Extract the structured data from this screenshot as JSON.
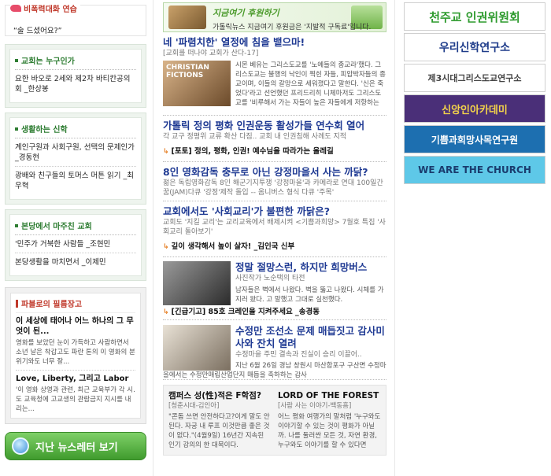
{
  "left": {
    "dialog": {
      "title": "비폭력대화 연습",
      "text": "“술 드셨어요?”"
    },
    "church": {
      "title": "교회는 누구인가",
      "items": [
        "요한 바오로 2세와 제2차 바티칸공의회 _한상봉"
      ]
    },
    "faith": {
      "title": "생활하는 신학",
      "items": [
        "계인구원과 사회구원, 선택의 문제인가 _경동현",
        "광배와 친구들의 토머스 머튼 읽기 _최우혁"
      ]
    },
    "meet": {
      "title": "본당에서 마주친 교회",
      "items": [
        "'민주가 거북한 사람들 _조현민",
        "본당생활을 마치면서 _이제민"
      ]
    },
    "ad": {
      "title": "파블로의 필름장고",
      "item1_title": "이 세상에 태어나 어느 하나의 그 무엇이 된...",
      "item1_desc": "영화를 보았던 눈이 가득하고 사람하면서 소년 날은 착갑고도 파란 톤의 이 영화의 분위기와도 너무 잘...",
      "item2_title": "Love, Liberty, 그리고 Labor",
      "item2_desc": "'이 영화 상영과 관련, 최근 교육부가 각 시.도 교육청에 고교생의 관람금지 지시를 내리는..."
    },
    "newsletter_button": "지난 뉴스레터 보기"
  },
  "center": {
    "banner": {
      "t1": "지금여기 후원하기",
      "t2": "가톨릭뉴스 지금여기 후원금은 '지발적 구독료'입니다."
    },
    "article1": {
      "title": "네 '파렴치한' 열정에 침을 뱉으마!",
      "sub": "[교회를 떠나야 교회가 산다-17]",
      "body": "시몬 베유는 그리스도교를 '노예들의 종교라'했다. 그리스도교는 불행의 낙인이 찍힌 자들, 피압박자들의 종교이며, 이들의 갈망으로 세워졌다고 말한다. '신은 죽었다'라고 선언했던 프리드리히 니체마저도 그리스도교를 '비루해서 가는 자들이 높은 자들에게 저항하는"
    },
    "article2": {
      "title": "가톨릭 정의 평화 인권운동 활성가들 연수회 열어",
      "sub": "각 교구 정평위 교류 확산 다짐.. 교회 내 인권침해 사례도 지적",
      "related": "[포토] 정의, 평화, 인권! 예수님을 따라가는 올레길"
    },
    "article3": {
      "title": "8인 영화감독 충무로 아닌 강정마을서 사는 까닭?",
      "sub": "젊은 독립영화감독 8인 해군기지투쟁 '강정마을'과 카메라로 연대 100일간 꿈(JAM)다큐 '강정'제작 돌입 -- 옴니버스 형식 다큐 '주목'"
    },
    "article4": {
      "title": "교회에서도 '사회교리'가 불편한 까닭은?",
      "sub": "교회도 '지킬 교리'는 교리교육에서 배제시켜 <기쁨과희망> 7월호 특집 '사회교리 돌아보기'",
      "related": "깊이 생각해서 높이 살자! _김인국 신부"
    },
    "article5": {
      "title": "정말 절망스런, 하지만 희망버스",
      "sub": "사진작가 노순택의 타전",
      "body": "남자들은 벽에서 나왔다. 벽을 뚫고 나왔다. 시체를 가지러 왔다. 고 말했고 그대로 실천했다.",
      "related": "[긴급기고] 85호 크레인을 지켜주세요 _송경동"
    },
    "article6": {
      "title": "수정만 조선소 문제 매듭짓고 감사미사와 잔치 열려",
      "sub": "수정마을 주민 결속과 진실이 승리 이끌어..",
      "body": "지난 6월 26일 경남 창원시 마산합포구 구산면 수정마을에서는 수정만매립산업단지 매듭을 축하하는 감사"
    },
    "bottom": {
      "left_title": "캠퍼스 성(性)적은 F학점?",
      "left_sub": "[청춘시대-김인아]",
      "left_body": "\"콘돔 쓰면 안전하다고?이게 말도 안된다. 자궁 내 루프 이것만큼 좋은 것이 없다.\"(4월9일) 16년간 지속된 인기 강의의 한 대목이다.",
      "right_title": "LORD OF THE FOREST",
      "right_sub": "[사람 사는 이야기-백동흠]",
      "right_body": "어느 평화 여행가의 말처럼 '누구와도 이야기할 수 있는 것이 평화가 아닐까. 나를 둘러싼 모든 것, 자연 환경, 누구와도 이야기를 할 수 있다면"
    }
  },
  "right": {
    "banners": [
      {
        "label": "천주교 인권위원회",
        "color": "#2e9b2e",
        "bg": "#ffffff"
      },
      {
        "label": "우리신학연구소",
        "color": "#1f3c8a",
        "bg": "#ffffff"
      },
      {
        "label": "제3시대그리스도교연구소",
        "color": "#444444",
        "bg": "#ffffff"
      },
      {
        "label": "신앙인아카데미",
        "color": "#f3d34a",
        "bg": "#4a2f78"
      },
      {
        "label": "기쁨과희망사목연구원",
        "color": "#ffffff",
        "bg": "#1d6fb0"
      },
      {
        "label": "WE ARE THE CHURCH",
        "color": "#1a3c6e",
        "bg": "#5ec8e8"
      }
    ]
  }
}
